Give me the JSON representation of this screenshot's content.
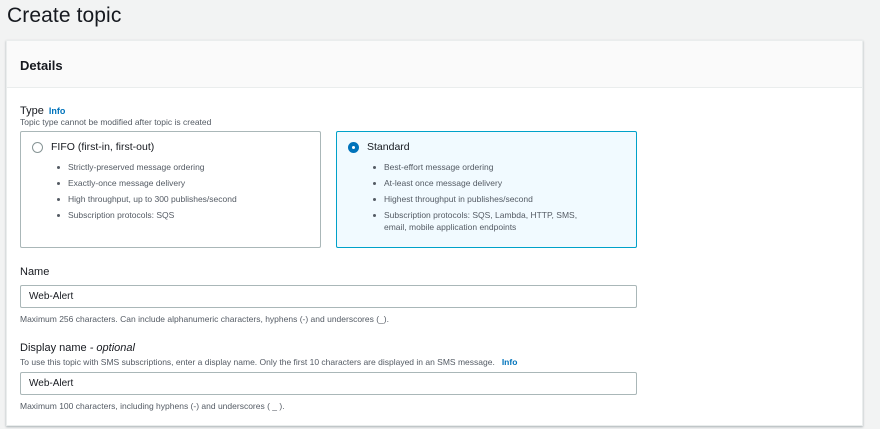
{
  "page": {
    "title": "Create topic"
  },
  "details": {
    "section_title": "Details",
    "type": {
      "label": "Type",
      "info": "Info",
      "description": "Topic type cannot be modified after topic is created",
      "options": [
        {
          "title": "FIFO (first-in, first-out)",
          "selected": false,
          "bullets": [
            "Strictly-preserved message ordering",
            "Exactly-once message delivery",
            "High throughput, up to 300 publishes/second",
            "Subscription protocols: SQS"
          ]
        },
        {
          "title": "Standard",
          "selected": true,
          "bullets": [
            "Best-effort message ordering",
            "At-least once message delivery",
            "Highest throughput in publishes/second",
            "Subscription protocols: SQS, Lambda, HTTP, SMS,",
            "email, mobile application endpoints"
          ]
        }
      ]
    },
    "name": {
      "label": "Name",
      "value": "Web-Alert",
      "constraint": "Maximum 256 characters. Can include alphanumeric characters, hyphens (-) and underscores (_)."
    },
    "display_name": {
      "label": "Display name",
      "optional": "- optional",
      "description": "To use this topic with SMS subscriptions, enter a display name. Only the first 10 characters are displayed in an SMS message.",
      "info": "Info",
      "value": "Web-Alert",
      "constraint": "Maximum 100 characters, including hyphens (-) and underscores ( _ )."
    }
  },
  "colors": {
    "accent": "#0073bb",
    "selected_border": "#00a1c9",
    "selected_bg": "#f1faff",
    "page_bg": "#f2f3f3"
  }
}
